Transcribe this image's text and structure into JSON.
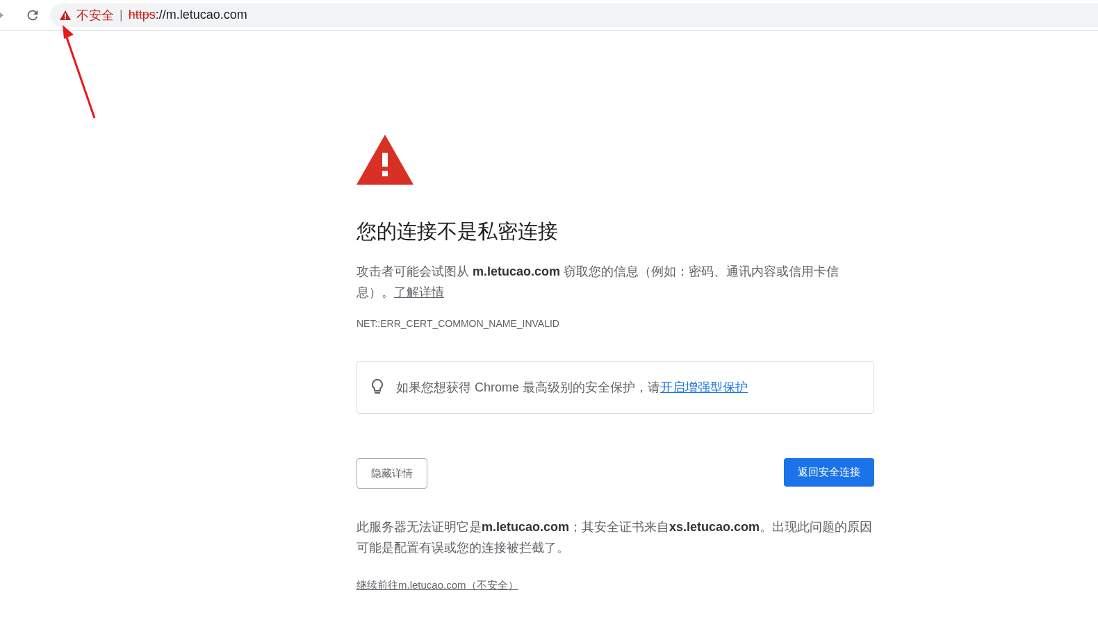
{
  "address_bar": {
    "security_label": "不安全",
    "separator": "|",
    "url_scheme": "https",
    "url_rest": "://m.letucao.com"
  },
  "error": {
    "title": "您的连接不是私密连接",
    "description": "攻击者可能会试图从 **m.letucao.com** 窃取您的信息（例如：密码、通讯内容或信用卡信息）。",
    "learn_more": "了解详情",
    "error_code": "NET::ERR_CERT_COMMON_NAME_INVALID",
    "tip": "如果您想获得 Chrome 最高级别的安全保护，请",
    "tip_link": "开启增强型保护",
    "hide_details_button": "隐藏详情",
    "back_button": "返回安全连接",
    "details": "此服务器无法证明它是**m.letucao.com**；其安全证书来自**xs.letucao.com**。出现此问题的原因可能是配置有误或您的连接被拦截了。",
    "proceed_link": "继续前往m.letucao.com（不安全）"
  }
}
